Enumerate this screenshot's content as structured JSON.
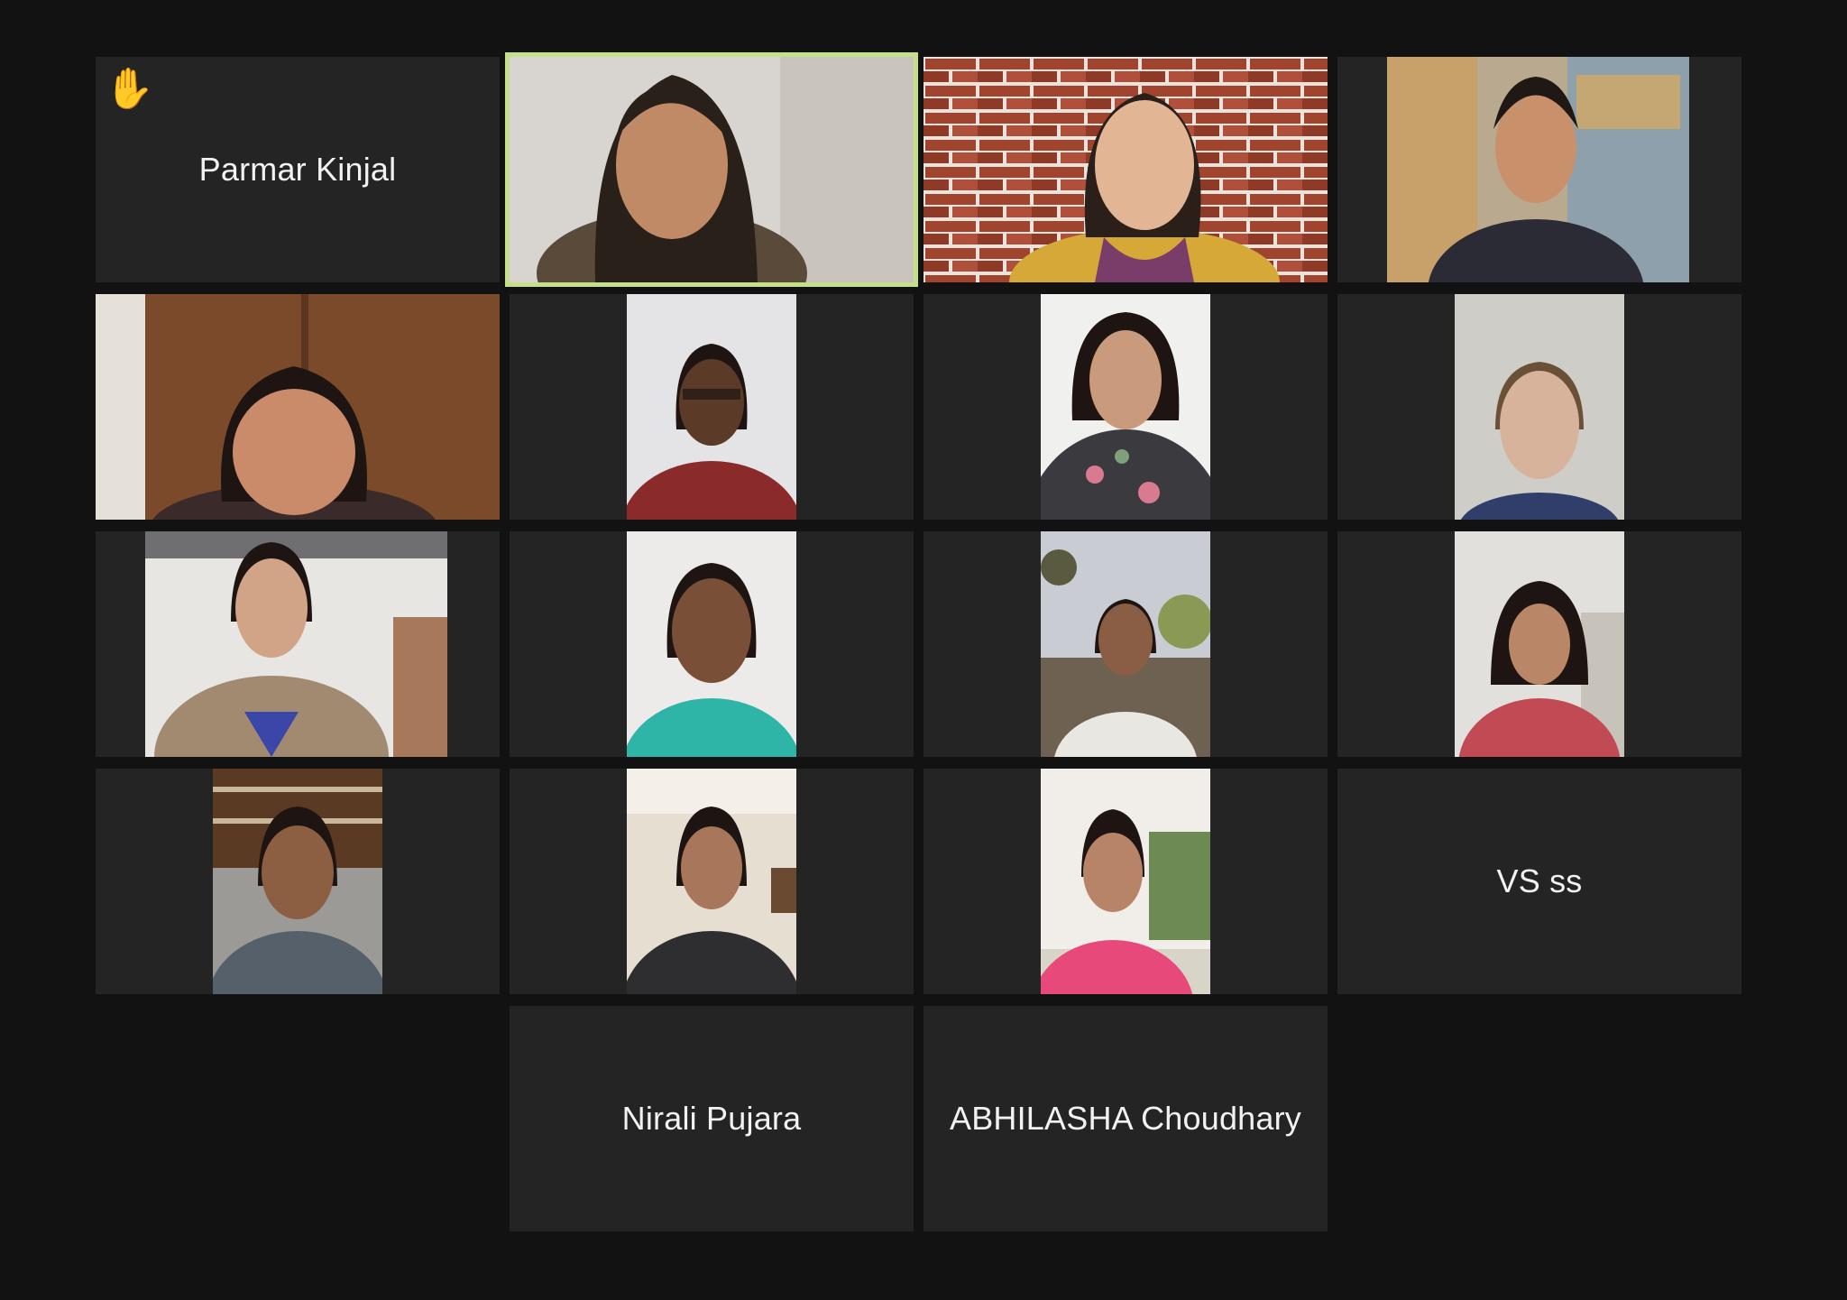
{
  "meeting": {
    "gallery_view": true,
    "active_speaker_color": "#c5e08a"
  },
  "participants": [
    {
      "label": "Parmar Kinjal",
      "hand_raised": true,
      "hand_icon": "raised-hand-icon",
      "video": false
    },
    {
      "label": "",
      "video": true,
      "active_speaker": true
    },
    {
      "label": "",
      "video": true
    },
    {
      "label": "",
      "video": true
    },
    {
      "label": "",
      "video": true
    },
    {
      "label": "",
      "video": true
    },
    {
      "label": "",
      "video": true
    },
    {
      "label": "",
      "video": true
    },
    {
      "label": "",
      "video": true
    },
    {
      "label": "",
      "video": true
    },
    {
      "label": "",
      "video": true
    },
    {
      "label": "",
      "video": true
    },
    {
      "label": "",
      "video": true
    },
    {
      "label": "",
      "video": true
    },
    {
      "label": "",
      "video": true
    },
    {
      "label": "VS ss",
      "video": false
    },
    {
      "label": "Nirali Pujara",
      "video": false
    },
    {
      "label": "ABHILASHA Choudhary",
      "video": false
    }
  ],
  "hand_glyph": "✋"
}
